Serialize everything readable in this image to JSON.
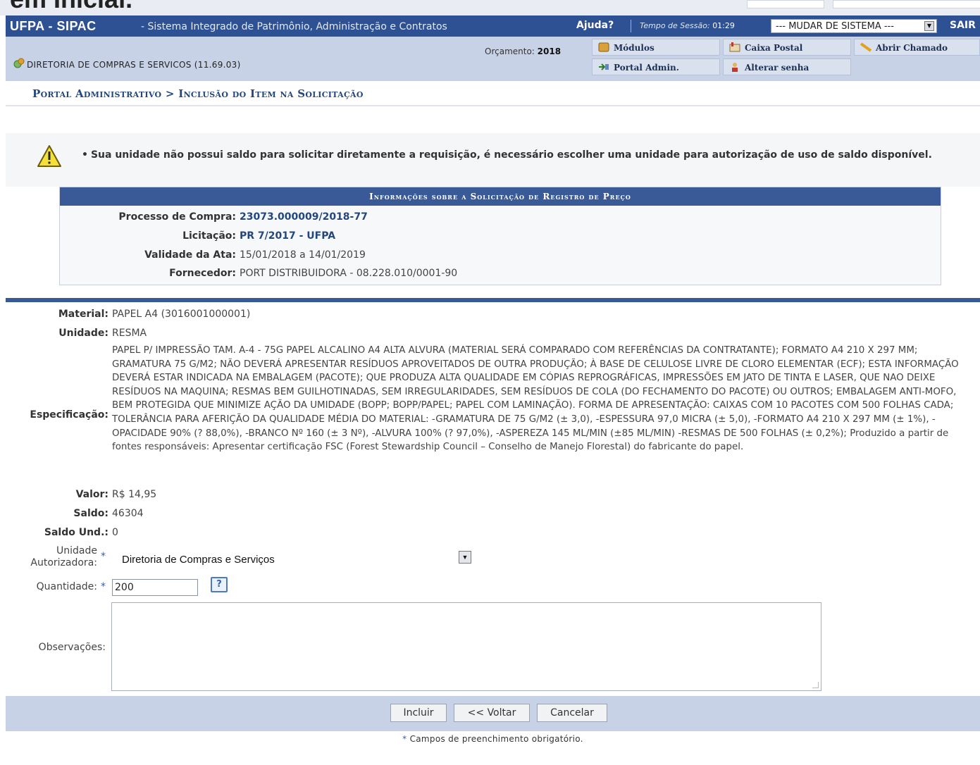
{
  "top_strip": {
    "partial_text": "em Inicial."
  },
  "header": {
    "brand": "UFPA - SIPAC",
    "subtitle": "- Sistema Integrado de Patrimônio, Administração e Contratos",
    "help": "Ajuda?",
    "session_label": "Tempo de Sessão:",
    "session_time": "01:29",
    "system_select": "--- MUDAR DE SISTEMA ---",
    "exit": "SAIR"
  },
  "subheader": {
    "unit": "DIRETORIA DE COMPRAS E SERVICOS (11.69.03)",
    "budget_label": "Orçamento:",
    "budget_year": "2018",
    "menu": {
      "modulos": "Módulos",
      "caixa_postal": "Caixa Postal",
      "abrir_chamado": "Abrir Chamado",
      "portal_admin": "Portal Admin.",
      "alterar_senha": "Alterar senha"
    }
  },
  "breadcrumb": "Portal Administrativo > Inclusão do Item na Solicitação",
  "alert": {
    "bullet": "•",
    "message": "Sua unidade não possui saldo para solicitar diretamente a requisição, é necessário escolher uma unidade para autorização de uso de saldo disponível."
  },
  "info": {
    "title": "Informações sobre a Solicitação de Registro de Preço",
    "processo_label": "Processo de Compra:",
    "processo_value": "23073.000009/2018-77",
    "licitacao_label": "Licitação:",
    "licitacao_value": "PR 7/2017 - UFPA",
    "validade_label": "Validade da Ata:",
    "validade_value": "15/01/2018 a 14/01/2019",
    "fornecedor_label": "Fornecedor:",
    "fornecedor_value": "PORT DISTRIBUIDORA - 08.228.010/0001-90"
  },
  "item": {
    "material_label": "Material:",
    "material_value": "PAPEL A4 (3016001000001)",
    "unidade_label": "Unidade:",
    "unidade_value": "RESMA",
    "especificacao_label": "Especificação:",
    "especificacao_value": "PAPEL P/ IMPRESSÃO TAM. A-4 - 75G PAPEL ALCALINO A4 ALTA ALVURA (MATERIAL SERÁ COMPARADO COM REFERÊNCIAS DA CONTRATANTE); FORMATO A4 210 X 297 MM; GRAMATURA 75 G/M2; NÃO DEVERÁ APRESENTAR RESÍDUOS APROVEITADOS DE OUTRA PRODUÇÃO; À BASE DE CELULOSE LIVRE DE CLORO ELEMENTAR (ECF); ESTA INFORMAÇÃO DEVERÁ ESTAR INDICADA NA EMBALAGEM (PACOTE); QUE PRODUZA ALTA QUALIDADE EM CÓPIAS REPROGRÁFICAS, IMPRESSÕES EM JATO DE TINTA E LASER, QUE NAO DEIXE RESÍDUOS NA MAQUINA; RESMAS BEM GUILHOTINADAS, SEM IRREGULARIDADES, SEM RESÍDUOS DE COLA (DO FECHAMENTO DO PACOTE) OU OUTROS; EMBALAGEM ANTI-MOFO, BEM PROTEGIDA QUE MINIMIZE AÇÃO DA UMIDADE (BOPP; BOPP/PAPEL; PAPEL COM LAMINAÇÃO). FORMA DE APRESENTAÇÃO: CAIXAS COM 10 PACOTES COM 500 FOLHAS CADA; TOLERÂNCIA PARA AFERIÇÃO DA QUALIDADE MÉDIA DO MATERIAL: -GRAMATURA DE 75 G/M2 (± 3,0), -ESPESSURA 97,0 MICRA (± 5,0), -FORMATO A4 210 X 297 MM (± 1%), -OPACIDADE 90% (? 88,0%), -BRANCO Nº 160 (± 3 Nº), -ALVURA 100% (? 97,0%), -ASPEREZA 145 ML/MIN (±85 ML/MIN) -RESMAS DE 500 FOLHAS (± 0,2%); Produzido a partir de fontes responsáveis: Apresentar certificação FSC (Forest Stewardship Council – Conselho de Manejo Florestal) do fabricante do papel.",
    "valor_label": "Valor:",
    "valor_value": "R$ 14,95",
    "saldo_label": "Saldo:",
    "saldo_value": "46304",
    "saldo_und_label": "Saldo Und.:",
    "saldo_und_value": "0"
  },
  "form": {
    "required_mark": "*",
    "unidade_label_1": "Unidade",
    "unidade_label_2": "Autorizadora:",
    "unidade_selected": "Diretoria de Compras e Serviços",
    "quantidade_label": "Quantidade:",
    "quantidade_value": "200",
    "help_icon_text": "?",
    "observacoes_label": "Observações:",
    "observacoes_value": ""
  },
  "buttons": {
    "incluir": "Incluir",
    "voltar": "<< Voltar",
    "cancelar": "Cancelar"
  },
  "footer": {
    "required_note": "Campos de preenchimento obrigatório."
  },
  "colors": {
    "header_blue": "#2d5193",
    "subheader_bg": "#c8d2e6",
    "section_blue": "#3a5a97",
    "link_blue": "#23467d"
  }
}
